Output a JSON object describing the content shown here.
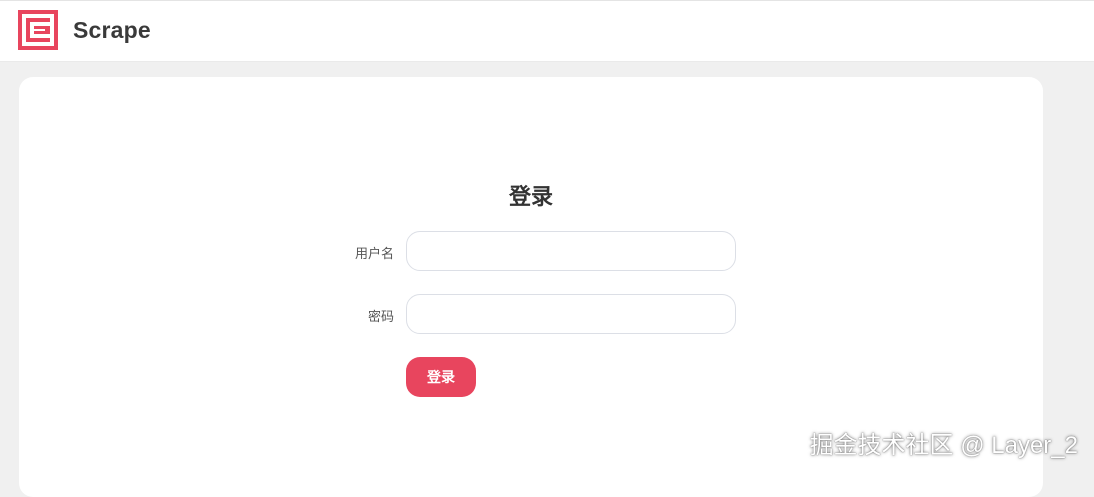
{
  "header": {
    "brand": "Scrape",
    "logo_icon": "scrape-logo-icon"
  },
  "login": {
    "title": "登录",
    "username_label": "用户名",
    "username_value": "",
    "password_label": "密码",
    "password_value": "",
    "submit_label": "登录"
  },
  "watermark": "掘金技术社区 @ Layer_2",
  "colors": {
    "accent": "#e8455e",
    "page_background": "#f0f0f0",
    "card_background": "#ffffff"
  }
}
